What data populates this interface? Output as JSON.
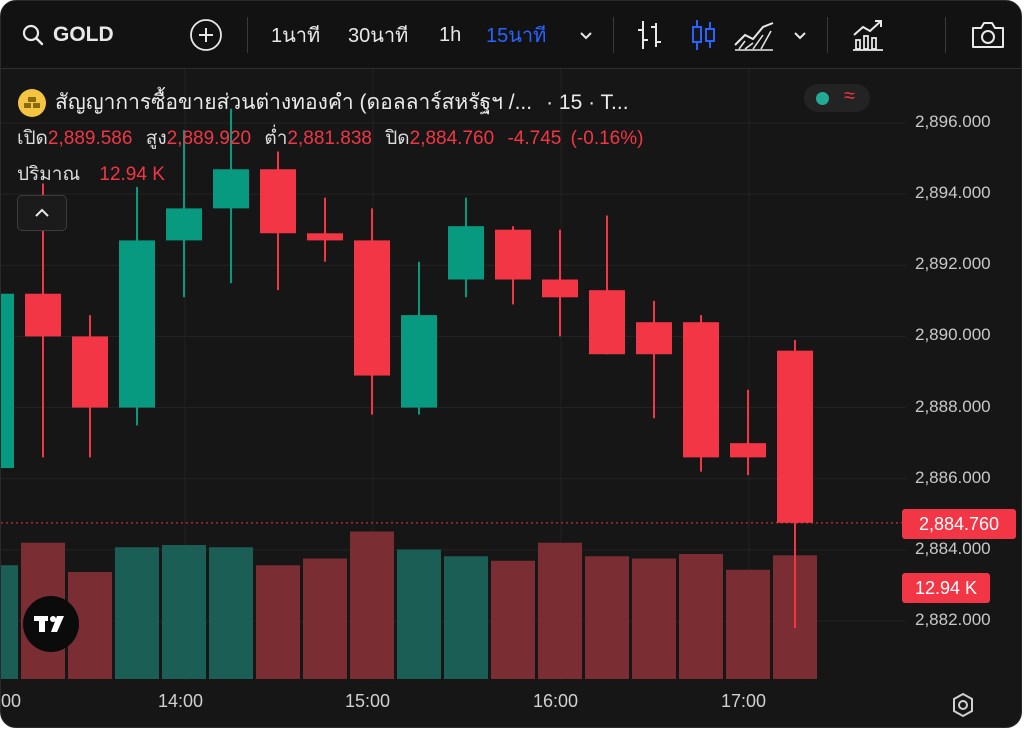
{
  "toolbar": {
    "symbol": "GOLD",
    "intervals": [
      "1นาที",
      "30นาที",
      "1h",
      "15นาที"
    ],
    "active_interval": "15นาที",
    "icons": [
      "search-icon",
      "add-symbol-icon",
      "chevron-down-icon",
      "bar-chart-icon",
      "candles-icon",
      "area-chart-icon",
      "chevron-down-icon",
      "indicators-icon",
      "camera-icon"
    ]
  },
  "legend": {
    "title": "สัญญาการซื้อขายส่วนต่างทองคำ (ดอลลาร์สหรัฐฯ /...",
    "interval": "· 15 · T...",
    "open_label": "เปิด",
    "open": "2,889.586",
    "high_label": "สูง",
    "high": "2,889.920",
    "low_label": "ต่ำ",
    "low": "2,881.838",
    "close_label": "ปิด",
    "close": "2,884.760",
    "change": "-4.745",
    "change_pct": "(-0.16%)",
    "volume_label": "ปริมาณ",
    "volume": "12.94 K",
    "collapse_icon": "chevron-up-icon"
  },
  "price_axis": {
    "labels": [
      "2,896.000",
      "2,894.000",
      "2,892.000",
      "2,890.000",
      "2,888.000",
      "2,886.000",
      "2,884.000",
      "2,882.000"
    ],
    "last_price": "2,884.760",
    "volume_badge": "12.94 K"
  },
  "time_axis": {
    "labels": [
      "00",
      "14:00",
      "15:00",
      "16:00",
      "17:00"
    ],
    "settings_icon": "settings-icon"
  },
  "colors": {
    "up": "#089981",
    "down": "#f23645",
    "background": "#161616",
    "accent": "#2962ff"
  },
  "chart_data": {
    "type": "candlestick",
    "x": [
      "13:15",
      "13:30",
      "13:45",
      "14:00",
      "14:15",
      "14:30",
      "14:45",
      "15:00",
      "15:15",
      "15:30",
      "15:45",
      "16:00",
      "16:15",
      "16:30",
      "16:45",
      "17:00",
      "17:15",
      "17:30"
    ],
    "open": [
      2886.3,
      2891.2,
      2890.0,
      2888.0,
      2892.7,
      2893.6,
      2894.7,
      2892.9,
      2892.7,
      2888.0,
      2891.6,
      2893.0,
      2891.6,
      2891.3,
      2890.4,
      2890.4,
      2887.0,
      2889.6
    ],
    "high": [
      2893.0,
      2894.3,
      2890.6,
      2894.2,
      2895.8,
      2896.4,
      2895.2,
      2893.9,
      2893.6,
      2892.1,
      2893.9,
      2893.1,
      2893.0,
      2893.4,
      2891.0,
      2890.6,
      2888.5,
      2889.9
    ],
    "low": [
      2886.0,
      2886.6,
      2886.6,
      2887.5,
      2891.1,
      2891.5,
      2891.3,
      2892.1,
      2887.8,
      2887.8,
      2891.1,
      2890.9,
      2890.0,
      2889.5,
      2887.7,
      2886.2,
      2886.1,
      2881.8
    ],
    "close": [
      2891.2,
      2890.0,
      2888.0,
      2892.7,
      2893.6,
      2894.7,
      2892.9,
      2892.7,
      2888.9,
      2890.6,
      2893.1,
      2891.6,
      2891.1,
      2889.5,
      2889.5,
      2886.6,
      2886.6,
      2884.76
    ],
    "volume": [
      12.5,
      13.5,
      12.2,
      13.3,
      13.4,
      13.3,
      12.5,
      12.8,
      14.0,
      13.2,
      12.9,
      12.7,
      13.5,
      12.9,
      12.8,
      13.0,
      12.3,
      12.94
    ],
    "ylim": [
      2881.0,
      2897.2
    ]
  }
}
